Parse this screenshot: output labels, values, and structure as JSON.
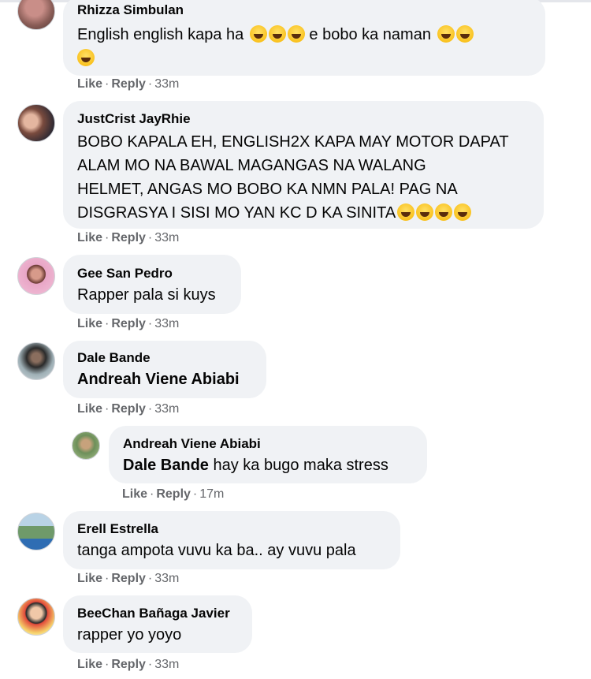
{
  "actions": {
    "like": "Like",
    "reply": "Reply",
    "dot": "·"
  },
  "comments": [
    {
      "author": "Rhizza Simbulan",
      "text_before": "English english kapa ha",
      "text_mid": "e bobo ka naman",
      "emoji": "laughing-tears",
      "time": "33m"
    },
    {
      "author": "JustCrist JayRhie",
      "lines": [
        "BOBO KAPALA EH, ENGLISH2X KAPA MAY MOTOR DAPAT",
        "ALAM MO NA BAWAL MAGANGAS NA WALANG",
        "HELMET, ANGAS MO BOBO KA NMN PALA! PAG NA",
        "DISGRASYA I SISI MO YAN KC D KA SINITA"
      ],
      "emoji": "grimacing-face",
      "time": "33m"
    },
    {
      "author": "Gee San Pedro",
      "text": "Rapper pala si kuys",
      "time": "33m"
    },
    {
      "author": "Dale Bande",
      "tag": "Andreah Viene Abiabi",
      "text": "",
      "time": "33m"
    },
    {
      "author": "Andreah Viene Abiabi",
      "tag": "Dale Bande",
      "text": "hay ka bugo maka stress",
      "time": "17m",
      "reply": true
    },
    {
      "author": "Erell Estrella",
      "text": "tanga ampota vuvu ka ba.. ay vuvu pala",
      "time": "33m"
    },
    {
      "author": "BeeChan Bañaga Javier",
      "text": "rapper yo yoyo",
      "time": "33m"
    }
  ]
}
